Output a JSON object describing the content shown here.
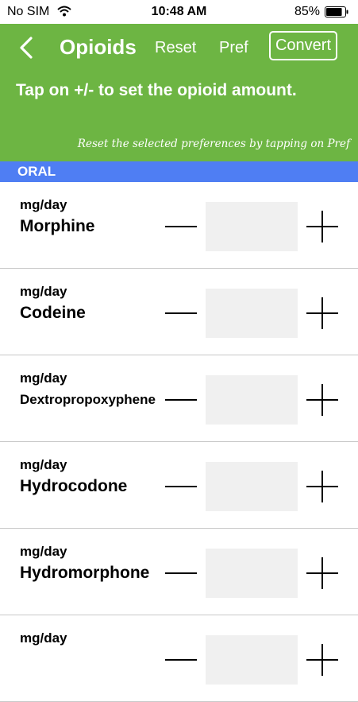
{
  "status_bar": {
    "carrier": "No SIM",
    "time": "10:48 AM",
    "battery_percent": "85%",
    "battery_level": 0.85
  },
  "header": {
    "title": "Opioids",
    "reset_label": "Reset",
    "pref_label": "Pref",
    "convert_label": "Convert",
    "instruction": "Tap on +/- to set the opioid amount.",
    "note": "Reset the selected preferences by tapping on Pref",
    "background_color": "#6db543"
  },
  "section": {
    "label": "ORAL",
    "color": "#4f7ef3"
  },
  "rows": [
    {
      "unit": "mg/day",
      "drug": "Morphine",
      "value": ""
    },
    {
      "unit": "mg/day",
      "drug": "Codeine",
      "value": ""
    },
    {
      "unit": "mg/day",
      "drug": "Dextropropoxyphene",
      "value": ""
    },
    {
      "unit": "mg/day",
      "drug": "Hydrocodone",
      "value": ""
    },
    {
      "unit": "mg/day",
      "drug": "Hydromorphone",
      "value": ""
    },
    {
      "unit": "mg/day",
      "drug": "",
      "value": ""
    }
  ],
  "icons": {
    "back": "chevron-left-icon",
    "wifi": "wifi-icon",
    "battery": "battery-icon",
    "decrement": "minus-icon",
    "increment": "plus-icon"
  }
}
